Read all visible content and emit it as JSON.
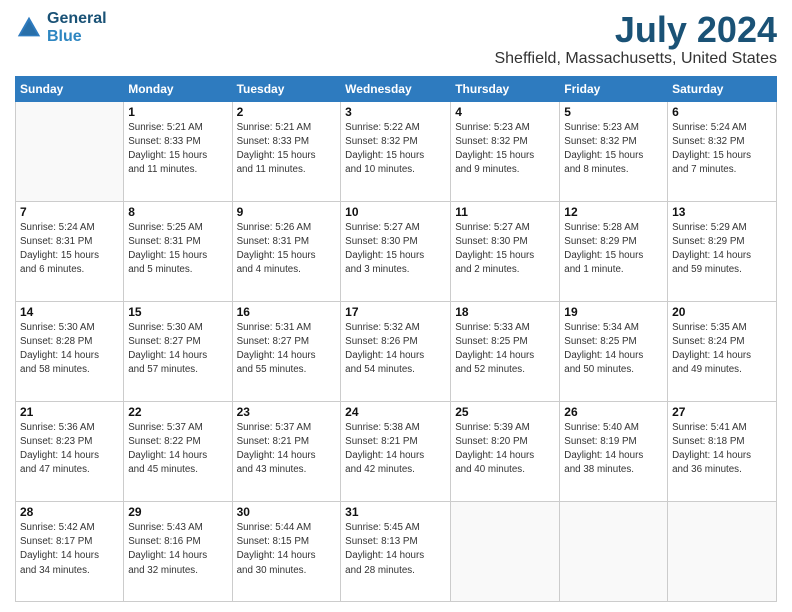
{
  "logo": {
    "line1": "General",
    "line2": "Blue"
  },
  "title": "July 2024",
  "location": "Sheffield, Massachusetts, United States",
  "weekdays": [
    "Sunday",
    "Monday",
    "Tuesday",
    "Wednesday",
    "Thursday",
    "Friday",
    "Saturday"
  ],
  "weeks": [
    [
      {
        "day": "",
        "info": ""
      },
      {
        "day": "1",
        "info": "Sunrise: 5:21 AM\nSunset: 8:33 PM\nDaylight: 15 hours\nand 11 minutes."
      },
      {
        "day": "2",
        "info": "Sunrise: 5:21 AM\nSunset: 8:33 PM\nDaylight: 15 hours\nand 11 minutes."
      },
      {
        "day": "3",
        "info": "Sunrise: 5:22 AM\nSunset: 8:32 PM\nDaylight: 15 hours\nand 10 minutes."
      },
      {
        "day": "4",
        "info": "Sunrise: 5:23 AM\nSunset: 8:32 PM\nDaylight: 15 hours\nand 9 minutes."
      },
      {
        "day": "5",
        "info": "Sunrise: 5:23 AM\nSunset: 8:32 PM\nDaylight: 15 hours\nand 8 minutes."
      },
      {
        "day": "6",
        "info": "Sunrise: 5:24 AM\nSunset: 8:32 PM\nDaylight: 15 hours\nand 7 minutes."
      }
    ],
    [
      {
        "day": "7",
        "info": "Sunrise: 5:24 AM\nSunset: 8:31 PM\nDaylight: 15 hours\nand 6 minutes."
      },
      {
        "day": "8",
        "info": "Sunrise: 5:25 AM\nSunset: 8:31 PM\nDaylight: 15 hours\nand 5 minutes."
      },
      {
        "day": "9",
        "info": "Sunrise: 5:26 AM\nSunset: 8:31 PM\nDaylight: 15 hours\nand 4 minutes."
      },
      {
        "day": "10",
        "info": "Sunrise: 5:27 AM\nSunset: 8:30 PM\nDaylight: 15 hours\nand 3 minutes."
      },
      {
        "day": "11",
        "info": "Sunrise: 5:27 AM\nSunset: 8:30 PM\nDaylight: 15 hours\nand 2 minutes."
      },
      {
        "day": "12",
        "info": "Sunrise: 5:28 AM\nSunset: 8:29 PM\nDaylight: 15 hours\nand 1 minute."
      },
      {
        "day": "13",
        "info": "Sunrise: 5:29 AM\nSunset: 8:29 PM\nDaylight: 14 hours\nand 59 minutes."
      }
    ],
    [
      {
        "day": "14",
        "info": "Sunrise: 5:30 AM\nSunset: 8:28 PM\nDaylight: 14 hours\nand 58 minutes."
      },
      {
        "day": "15",
        "info": "Sunrise: 5:30 AM\nSunset: 8:27 PM\nDaylight: 14 hours\nand 57 minutes."
      },
      {
        "day": "16",
        "info": "Sunrise: 5:31 AM\nSunset: 8:27 PM\nDaylight: 14 hours\nand 55 minutes."
      },
      {
        "day": "17",
        "info": "Sunrise: 5:32 AM\nSunset: 8:26 PM\nDaylight: 14 hours\nand 54 minutes."
      },
      {
        "day": "18",
        "info": "Sunrise: 5:33 AM\nSunset: 8:25 PM\nDaylight: 14 hours\nand 52 minutes."
      },
      {
        "day": "19",
        "info": "Sunrise: 5:34 AM\nSunset: 8:25 PM\nDaylight: 14 hours\nand 50 minutes."
      },
      {
        "day": "20",
        "info": "Sunrise: 5:35 AM\nSunset: 8:24 PM\nDaylight: 14 hours\nand 49 minutes."
      }
    ],
    [
      {
        "day": "21",
        "info": "Sunrise: 5:36 AM\nSunset: 8:23 PM\nDaylight: 14 hours\nand 47 minutes."
      },
      {
        "day": "22",
        "info": "Sunrise: 5:37 AM\nSunset: 8:22 PM\nDaylight: 14 hours\nand 45 minutes."
      },
      {
        "day": "23",
        "info": "Sunrise: 5:37 AM\nSunset: 8:21 PM\nDaylight: 14 hours\nand 43 minutes."
      },
      {
        "day": "24",
        "info": "Sunrise: 5:38 AM\nSunset: 8:21 PM\nDaylight: 14 hours\nand 42 minutes."
      },
      {
        "day": "25",
        "info": "Sunrise: 5:39 AM\nSunset: 8:20 PM\nDaylight: 14 hours\nand 40 minutes."
      },
      {
        "day": "26",
        "info": "Sunrise: 5:40 AM\nSunset: 8:19 PM\nDaylight: 14 hours\nand 38 minutes."
      },
      {
        "day": "27",
        "info": "Sunrise: 5:41 AM\nSunset: 8:18 PM\nDaylight: 14 hours\nand 36 minutes."
      }
    ],
    [
      {
        "day": "28",
        "info": "Sunrise: 5:42 AM\nSunset: 8:17 PM\nDaylight: 14 hours\nand 34 minutes."
      },
      {
        "day": "29",
        "info": "Sunrise: 5:43 AM\nSunset: 8:16 PM\nDaylight: 14 hours\nand 32 minutes."
      },
      {
        "day": "30",
        "info": "Sunrise: 5:44 AM\nSunset: 8:15 PM\nDaylight: 14 hours\nand 30 minutes."
      },
      {
        "day": "31",
        "info": "Sunrise: 5:45 AM\nSunset: 8:13 PM\nDaylight: 14 hours\nand 28 minutes."
      },
      {
        "day": "",
        "info": ""
      },
      {
        "day": "",
        "info": ""
      },
      {
        "day": "",
        "info": ""
      }
    ]
  ]
}
